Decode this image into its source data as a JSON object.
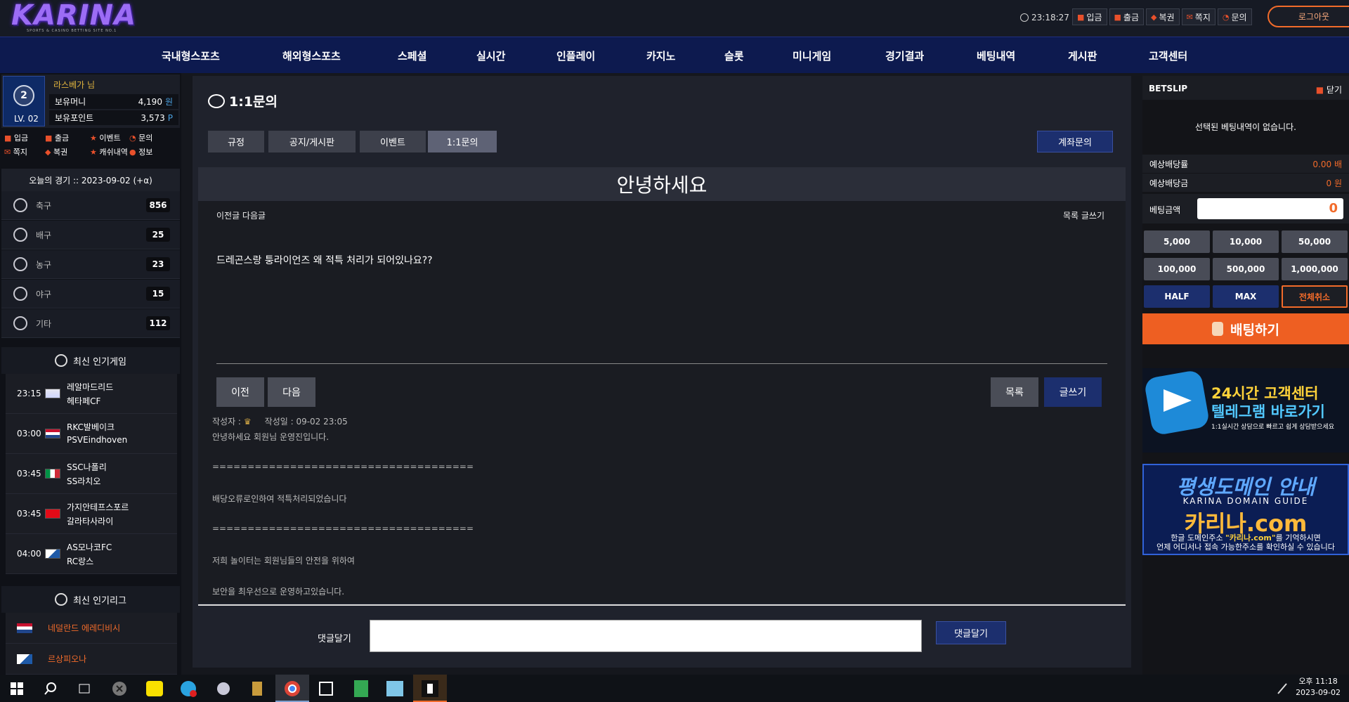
{
  "header": {
    "logo": "KARINA",
    "logo_sub": "SPORTS & CASINO BETTING SITE NO.1",
    "time": "23:18:27",
    "buttons": [
      "입금",
      "출금",
      "복권",
      "쪽지",
      "문의"
    ],
    "logout": "로그아웃"
  },
  "nav": [
    "국내형스포츠",
    "해외형스포츠",
    "스페셜",
    "실시간",
    "인플레이",
    "카지노",
    "슬롯",
    "미니게임",
    "경기결과",
    "베팅내역",
    "게시판",
    "고객센터"
  ],
  "user": {
    "level_badge": "2",
    "level": "LV. 02",
    "name": "라스베가 님",
    "money_label": "보유머니",
    "money": "4,190",
    "money_unit": "원",
    "points_label": "보유포인트",
    "points": "3,573",
    "points_unit": "P",
    "quick_row1": [
      "입금",
      "출금",
      "이벤트",
      "문의"
    ],
    "quick_row2": [
      "쪽지",
      "복권",
      "캐쉬내역",
      "정보"
    ]
  },
  "today": "오늘의 경기 :: 2023-09-02 (+α)",
  "sports": [
    {
      "name": "축구",
      "count": "856"
    },
    {
      "name": "배구",
      "count": "25"
    },
    {
      "name": "농구",
      "count": "23"
    },
    {
      "name": "야구",
      "count": "15"
    },
    {
      "name": "기타",
      "count": "112"
    }
  ],
  "popular_games_title": "최신 인기게임",
  "games": [
    {
      "time": "23:15",
      "home": "레알마드리드",
      "away": "헤타페CF"
    },
    {
      "time": "03:00",
      "home": "RKC발베이크",
      "away": "PSVEindhoven"
    },
    {
      "time": "03:45",
      "home": "SSC나폴리",
      "away": "SS라치오"
    },
    {
      "time": "03:45",
      "home": "가지안테프스포르",
      "away": "갈라타사라이"
    },
    {
      "time": "04:00",
      "home": "AS모나코FC",
      "away": "RC랑스"
    }
  ],
  "popular_leagues_title": "최신 인기리그",
  "leagues": [
    "네덜란드 에레디비시",
    "르상피오나"
  ],
  "page": {
    "title": "1:1문의",
    "tabs": [
      "규정",
      "공지/게시판",
      "이벤트",
      "1:1문의"
    ],
    "account_btn": "계좌문의"
  },
  "post": {
    "title": "안녕하세요",
    "nav_left": "이전글 다음글",
    "nav_right": "목록  글쓰기",
    "body": "드레곤스랑 퉁라이언즈 왜 적특 처리가 되어있나요??",
    "btn_prev": "이전",
    "btn_next": "다음",
    "btn_list": "목록",
    "btn_write": "글쓰기",
    "author_label": "작성자 :",
    "date": "작성일 : 09-02 23:05",
    "reply_lines": [
      "안녕하세요 회원님 운영진입니다.",
      "=====================================",
      "배당오류로인하여 적특처리되었습니다",
      "=====================================",
      "저희 놀이터는 회원님들의 안전을 위하여",
      "보안을 최우선으로 운영하고있습니다."
    ]
  },
  "comment": {
    "label": "댓글달기",
    "button": "댓글달기"
  },
  "betslip": {
    "title": "BETSLIP",
    "close": "닫기",
    "empty": "선택된 베팅내역이 없습니다.",
    "odds_label": "예상배당률",
    "odds": "0.00 배",
    "win_label": "예상배당금",
    "win": "0 원",
    "amount_label": "베팅금액",
    "amount": "0",
    "chips": [
      "5,000",
      "10,000",
      "50,000",
      "100,000",
      "500,000",
      "1,000,000"
    ],
    "half": "HALF",
    "max": "MAX",
    "cancel": "전체취소",
    "bet": "배팅하기"
  },
  "banner_tg": {
    "l1": "24시간 고객센터",
    "l2": "텔레그램 바로가기",
    "l3": "1:1실시간 상담으로 빠르고 쉽게 상담받으세요"
  },
  "banner_domain": {
    "l1": "평생도메인 안내",
    "l2": "KARINA DOMAIN GUIDE",
    "l3": "카리나.com",
    "l4a": "한글 도메인주소",
    "l4b": "\"카리나.com\"",
    "l4c": "를 기억하시면",
    "l5": "언제 어디서나 접속 가능한주소를 확인하실 수 있습니다"
  },
  "taskbar": {
    "time": "오후 11:18",
    "date": "2023-09-02"
  }
}
